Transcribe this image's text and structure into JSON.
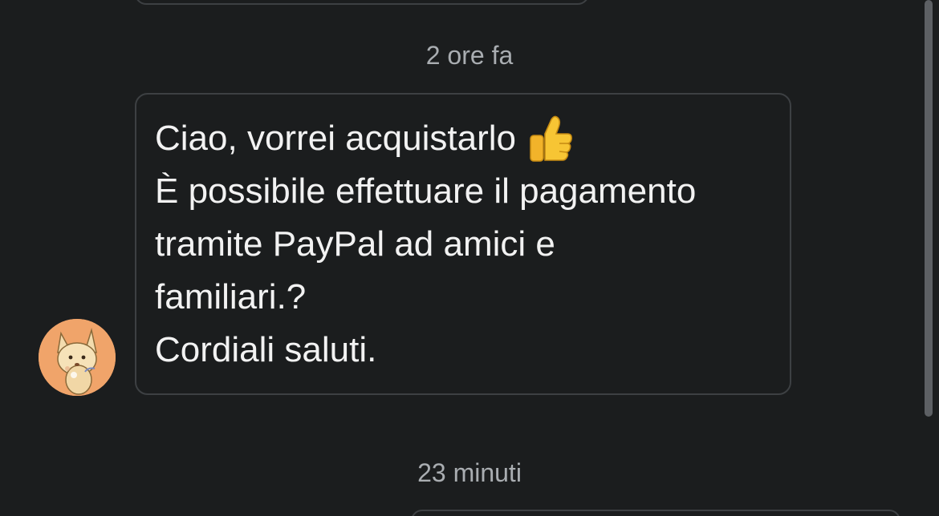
{
  "conversation": {
    "timestamps": [
      "2 ore fa",
      "23 minuti"
    ],
    "message": {
      "lines": [
        "Ciao, vorrei acquistarlo",
        "È possibile effettuare il pagamento",
        "tramite PayPal ad amici e",
        "familiari.?",
        "Cordiali saluti."
      ],
      "emoji": "thumbs-up-icon"
    },
    "avatar": {
      "icon": "fox-avatar-icon",
      "background": "#f0a46a"
    }
  },
  "colors": {
    "background": "#1b1d1e",
    "bubble_border": "#3d4043",
    "text": "#f2f2f2",
    "muted_text": "#a9adb1"
  }
}
